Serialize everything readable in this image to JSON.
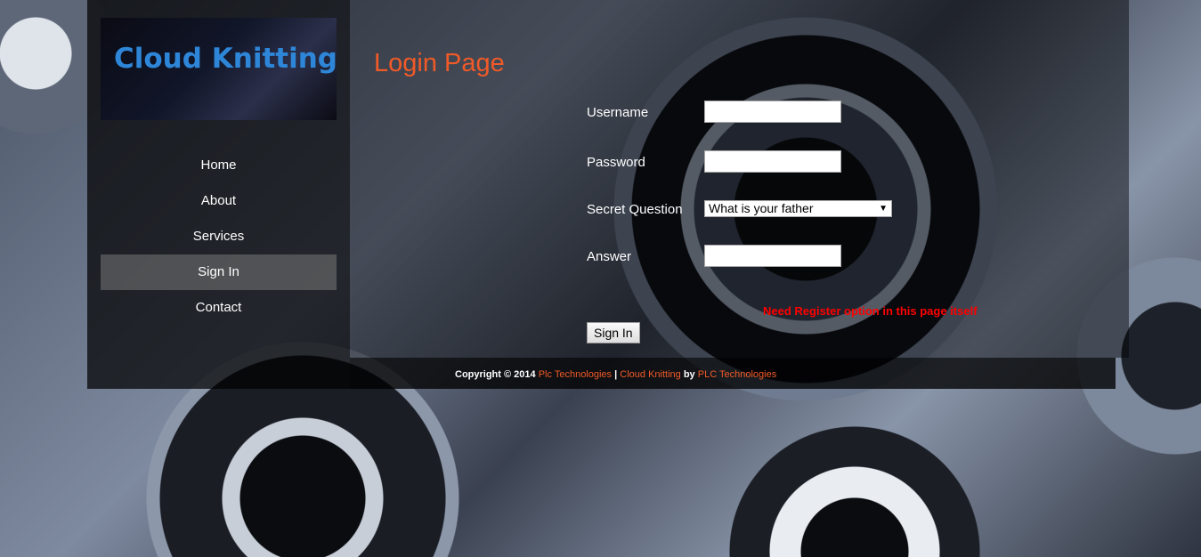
{
  "brand": {
    "logo_text": "Cloud Knitting"
  },
  "nav": {
    "items": [
      {
        "label": "Home"
      },
      {
        "label": "About"
      },
      {
        "label": "Services"
      },
      {
        "label": "Sign In",
        "active": true
      },
      {
        "label": "Contact"
      }
    ]
  },
  "main": {
    "title": "Login Page",
    "form": {
      "username_label": "Username",
      "username_value": "",
      "password_label": "Password",
      "password_value": "",
      "secret_question_label": "Secret Question",
      "secret_question_selected": "What is your father",
      "answer_label": "Answer",
      "answer_value": "",
      "submit_label": "Sign In"
    },
    "notice": "Need Register option in this page itself"
  },
  "footer": {
    "copyright_prefix": "Copyright © 2014",
    "link1": "Plc Technologies",
    "separator": "|",
    "link2": "Cloud Knitting",
    "by": "by",
    "link3": "PLC Technologies"
  },
  "colors": {
    "accent": "#f05a28",
    "logo": "#2e86d8",
    "warning": "#ff0000"
  }
}
